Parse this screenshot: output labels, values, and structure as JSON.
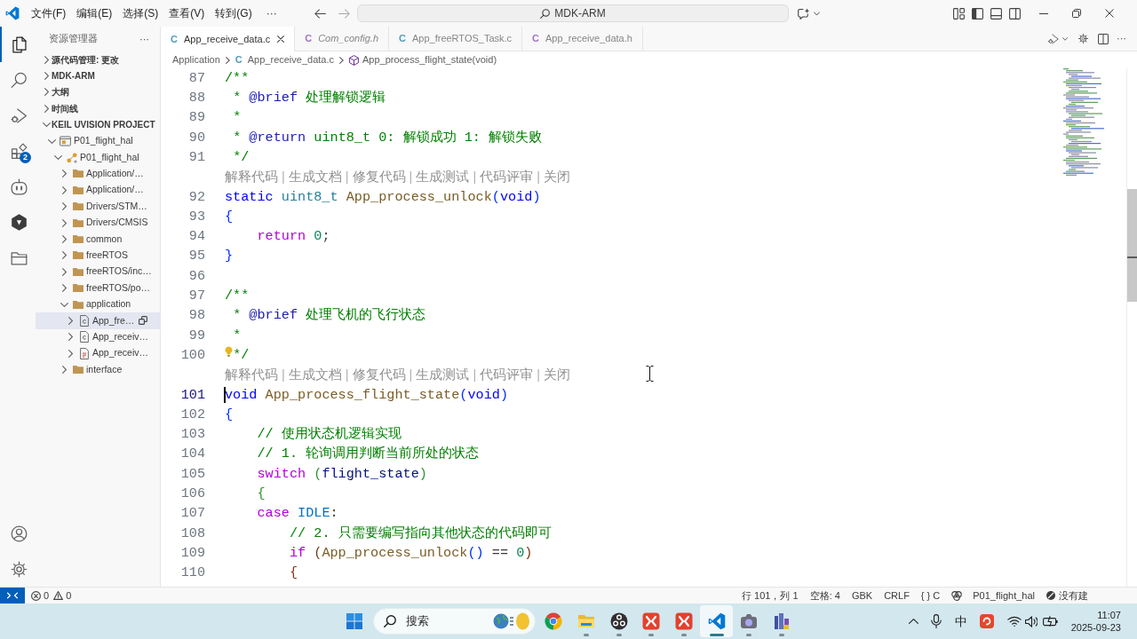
{
  "title_bar": {
    "menus": [
      {
        "label": "文件(F)"
      },
      {
        "label": "编辑(E)"
      },
      {
        "label": "选择(S)"
      },
      {
        "label": "查看(V)"
      },
      {
        "label": "转到(G)"
      }
    ],
    "more": "···",
    "command_center": "MDK-ARM"
  },
  "activity_bar": {
    "items": [
      {
        "kind": "explorer",
        "selected": true
      },
      {
        "kind": "search",
        "selected": false
      },
      {
        "kind": "run-debug",
        "selected": false
      },
      {
        "kind": "extensions",
        "selected": false,
        "badge": "2"
      },
      {
        "kind": "assistant",
        "selected": false
      },
      {
        "kind": "hexagon",
        "selected": false
      },
      {
        "kind": "folder",
        "selected": false
      }
    ],
    "bottom": [
      {
        "kind": "account"
      },
      {
        "kind": "settings"
      }
    ]
  },
  "sidebar": {
    "title": "资源管理器",
    "more": "···",
    "sections": [
      {
        "title": "源代码管理: 更改",
        "expanded": false
      },
      {
        "title": "MDK-ARM",
        "expanded": false
      },
      {
        "title": "大纲",
        "expanded": false
      },
      {
        "title": "时间线",
        "expanded": false
      },
      {
        "title": "KEIL UVISION PROJECT",
        "expanded": true,
        "tree": [
          {
            "label": "P01_flight_hal",
            "kind": "project",
            "expanded": true,
            "selected": false,
            "children": [
              {
                "label": "P01_flight_hal",
                "kind": "target",
                "expanded": true,
                "selected": false,
                "children": [
                  {
                    "label": "Application/…",
                    "kind": "folder",
                    "expanded": false,
                    "selected": false
                  },
                  {
                    "label": "Application/…",
                    "kind": "folder",
                    "expanded": false,
                    "selected": false
                  },
                  {
                    "label": "Drivers/STM…",
                    "kind": "folder",
                    "expanded": false,
                    "selected": false
                  },
                  {
                    "label": "Drivers/CMSIS",
                    "kind": "folder",
                    "expanded": false,
                    "selected": false
                  },
                  {
                    "label": "common",
                    "kind": "folder",
                    "expanded": false,
                    "selected": false
                  },
                  {
                    "label": "freeRTOS",
                    "kind": "folder",
                    "expanded": false,
                    "selected": false
                  },
                  {
                    "label": "freeRTOS/inc…",
                    "kind": "folder",
                    "expanded": false,
                    "selected": false
                  },
                  {
                    "label": "freeRTOS/po…",
                    "kind": "folder",
                    "expanded": false,
                    "selected": false
                  },
                  {
                    "label": "application",
                    "kind": "folder",
                    "expanded": true,
                    "selected": false,
                    "children": [
                      {
                        "label": "App_fre…",
                        "kind": "c-file",
                        "expanded": false,
                        "selected": true
                      },
                      {
                        "label": "App_receiv…",
                        "kind": "c-file",
                        "expanded": false,
                        "selected": false
                      },
                      {
                        "label": "App_receiv…",
                        "kind": "h-file",
                        "expanded": false,
                        "selected": false
                      }
                    ]
                  },
                  {
                    "label": "interface",
                    "kind": "folder",
                    "expanded": false,
                    "selected": false
                  }
                ]
              }
            ]
          }
        ]
      }
    ]
  },
  "tabs": [
    {
      "label": "App_receive_data.c",
      "icon": "C",
      "color": "#519aba",
      "selected": true,
      "preview": false
    },
    {
      "label": "Com_config.h",
      "icon": "C",
      "color": "#a074c4",
      "selected": false,
      "preview": true
    },
    {
      "label": "App_freeRTOS_Task.c",
      "icon": "C",
      "color": "#519aba",
      "selected": false,
      "preview": false
    },
    {
      "label": "App_receive_data.h",
      "icon": "C",
      "color": "#a074c4",
      "selected": false,
      "preview": false
    }
  ],
  "tab_actions": {
    "more": "···"
  },
  "breadcrumb": [
    {
      "label": "Application",
      "kind": "folder"
    },
    {
      "label": "App_receive_data.c",
      "kind": "file",
      "icon": "C"
    },
    {
      "label": "App_process_flight_state(void)",
      "kind": "function"
    }
  ],
  "editor": {
    "lines": [
      {
        "kind": "code",
        "number": "87",
        "current": false,
        "tokens": [
          {
            "kind": "comment",
            "text": "/**"
          }
        ]
      },
      {
        "kind": "code",
        "number": "88",
        "current": false,
        "tokens": [
          {
            "kind": "comment",
            "text": " * "
          },
          {
            "kind": "doc-tag",
            "text": "@brief"
          },
          {
            "kind": "comment",
            "text": " 处理解锁逻辑"
          }
        ]
      },
      {
        "kind": "code",
        "number": "89",
        "current": false,
        "tokens": [
          {
            "kind": "comment",
            "text": " *"
          }
        ]
      },
      {
        "kind": "code",
        "number": "90",
        "current": false,
        "tokens": [
          {
            "kind": "comment",
            "text": " * "
          },
          {
            "kind": "doc-tag",
            "text": "@return"
          },
          {
            "kind": "comment",
            "text": " uint8_t 0: 解锁成功 1: 解锁失败"
          }
        ]
      },
      {
        "kind": "code",
        "number": "91",
        "current": false,
        "tokens": [
          {
            "kind": "comment",
            "text": " */"
          }
        ]
      },
      {
        "kind": "codelens",
        "separator": "|",
        "items": [
          {
            "text": "解释代码"
          },
          {
            "text": "生成文档"
          },
          {
            "text": "修复代码"
          },
          {
            "text": "生成测试"
          },
          {
            "text": "代码评审"
          },
          {
            "text": "关闭"
          }
        ]
      },
      {
        "kind": "code",
        "number": "92",
        "current": false,
        "tokens": [
          {
            "kind": "keyword",
            "text": "static"
          },
          {
            "kind": "type",
            "text": " uint8_t"
          },
          {
            "kind": "function",
            "text": " App_process_unlock"
          },
          {
            "kind": "bracket1",
            "text": "("
          },
          {
            "kind": "keyword",
            "text": "void"
          },
          {
            "kind": "bracket1",
            "text": ")"
          }
        ]
      },
      {
        "kind": "code",
        "number": "93",
        "current": false,
        "tokens": [
          {
            "kind": "bracket1",
            "text": "{"
          }
        ]
      },
      {
        "kind": "code",
        "number": "94",
        "current": false,
        "tokens": [
          {
            "kind": "control",
            "text": "    return"
          },
          {
            "kind": "number",
            "text": " 0"
          },
          {
            "kind": "plain",
            "text": ";"
          }
        ]
      },
      {
        "kind": "code",
        "number": "95",
        "current": false,
        "tokens": [
          {
            "kind": "bracket1",
            "text": "}"
          }
        ]
      },
      {
        "kind": "code",
        "number": "96",
        "current": false
      },
      {
        "kind": "code",
        "number": "97",
        "current": false,
        "tokens": [
          {
            "kind": "comment",
            "text": "/**"
          }
        ]
      },
      {
        "kind": "code",
        "number": "98",
        "current": false,
        "tokens": [
          {
            "kind": "comment",
            "text": " * "
          },
          {
            "kind": "doc-tag",
            "text": "@brief"
          },
          {
            "kind": "comment",
            "text": " 处理飞机的飞行状态"
          }
        ]
      },
      {
        "kind": "code",
        "number": "99",
        "current": false,
        "tokens": [
          {
            "kind": "comment",
            "text": " *"
          }
        ]
      },
      {
        "kind": "code",
        "number": "100",
        "current": false,
        "tokens": [
          {
            "kind": "lightbulb"
          },
          {
            "kind": "comment",
            "text": " */"
          }
        ]
      },
      {
        "kind": "codelens",
        "separator": "|",
        "items": [
          {
            "text": "解释代码"
          },
          {
            "text": "生成文档"
          },
          {
            "text": "修复代码"
          },
          {
            "text": "生成测试"
          },
          {
            "text": "代码评审"
          },
          {
            "text": "关闭"
          }
        ]
      },
      {
        "kind": "code",
        "number": "101",
        "current": true,
        "tokens": [
          {
            "kind": "cursor"
          },
          {
            "kind": "keyword",
            "text": "void"
          },
          {
            "kind": "function",
            "text": " App_process_flight_state"
          },
          {
            "kind": "bracket1",
            "text": "("
          },
          {
            "kind": "keyword",
            "text": "void"
          },
          {
            "kind": "bracket1",
            "text": ")"
          }
        ]
      },
      {
        "kind": "code",
        "number": "102",
        "current": false,
        "tokens": [
          {
            "kind": "bracket1",
            "text": "{"
          }
        ]
      },
      {
        "kind": "code",
        "number": "103",
        "current": false,
        "tokens": [
          {
            "kind": "comment",
            "text": "    // 使用状态机逻辑实现"
          }
        ]
      },
      {
        "kind": "code",
        "number": "104",
        "current": false,
        "tokens": [
          {
            "kind": "comment",
            "text": "    // 1. 轮询调用判断当前所处的状态"
          }
        ]
      },
      {
        "kind": "code",
        "number": "105",
        "current": false,
        "tokens": [
          {
            "kind": "control",
            "text": "    switch"
          },
          {
            "kind": "bracket2",
            "text": " ("
          },
          {
            "kind": "variable",
            "text": "flight_state"
          },
          {
            "kind": "bracket2",
            "text": ")"
          }
        ]
      },
      {
        "kind": "code",
        "number": "106",
        "current": false,
        "tokens": [
          {
            "kind": "bracket2",
            "text": "    {"
          }
        ]
      },
      {
        "kind": "code",
        "number": "107",
        "current": false,
        "tokens": [
          {
            "kind": "control",
            "text": "    case"
          },
          {
            "kind": "constant",
            "text": " IDLE"
          },
          {
            "kind": "plain",
            "text": ":"
          }
        ]
      },
      {
        "kind": "code",
        "number": "108",
        "current": false,
        "tokens": [
          {
            "kind": "comment",
            "text": "        // 2. 只需要编写指向其他状态的代码即可"
          }
        ]
      },
      {
        "kind": "code",
        "number": "109",
        "current": false,
        "tokens": [
          {
            "kind": "control",
            "text": "        if"
          },
          {
            "kind": "bracket3",
            "text": " ("
          },
          {
            "kind": "function",
            "text": "App_process_unlock"
          },
          {
            "kind": "bracket1",
            "text": "()"
          },
          {
            "kind": "plain",
            "text": " == "
          },
          {
            "kind": "number",
            "text": "0"
          },
          {
            "kind": "bracket3",
            "text": ")"
          }
        ]
      },
      {
        "kind": "code",
        "number": "110",
        "current": false,
        "tokens": [
          {
            "kind": "bracket3",
            "text": "        {"
          }
        ]
      }
    ]
  },
  "status_bar": {
    "problems": [
      {
        "kind": "error",
        "count": "0"
      },
      {
        "kind": "warning",
        "count": "0"
      }
    ],
    "items": [
      {
        "kind": "text",
        "text": "行 101，列 1"
      },
      {
        "kind": "text",
        "text": "空格: 4"
      },
      {
        "kind": "text",
        "text": "GBK"
      },
      {
        "kind": "text",
        "text": "CRLF"
      },
      {
        "kind": "text",
        "text": "{ } C"
      },
      {
        "kind": "project",
        "text": "P01_flight_hal"
      },
      {
        "kind": "build",
        "text": "没有建"
      }
    ]
  },
  "taskbar": {
    "search": {
      "label": "搜索"
    },
    "apps": [
      {
        "kind": "chrome",
        "running": false,
        "active": false
      },
      {
        "kind": "file-explorer",
        "running": true,
        "active": false
      },
      {
        "kind": "obs",
        "running": true,
        "active": false
      },
      {
        "kind": "red-app",
        "running": true,
        "active": false
      },
      {
        "kind": "red-app",
        "running": true,
        "active": false
      },
      {
        "kind": "vscode",
        "running": true,
        "active": true
      },
      {
        "kind": "camera",
        "running": true,
        "active": false
      },
      {
        "kind": "building-app",
        "running": true,
        "active": false
      }
    ],
    "tray": {
      "ime": "中"
    },
    "time": "11:07",
    "date": "2025-09-23"
  }
}
